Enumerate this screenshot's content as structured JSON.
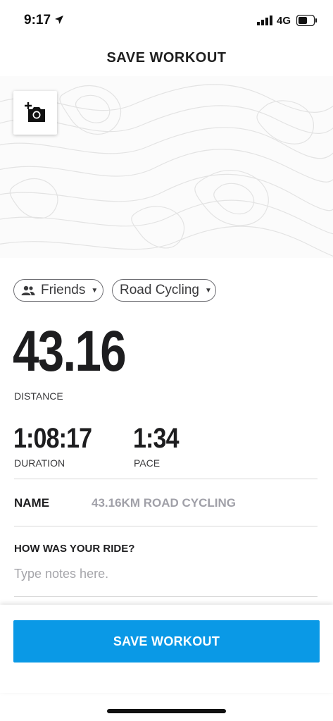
{
  "status_bar": {
    "time": "9:17",
    "network": "4G"
  },
  "header": {
    "title": "SAVE WORKOUT"
  },
  "privacy_chip": {
    "label": "Friends"
  },
  "activity_chip": {
    "label": "Road Cycling"
  },
  "distance": {
    "value": "43.16",
    "label": "DISTANCE"
  },
  "duration": {
    "value": "1:08:17",
    "label": "DURATION"
  },
  "pace": {
    "value": "1:34",
    "label": "PACE"
  },
  "name_row": {
    "label": "NAME",
    "value": "43.16KM ROAD CYCLING"
  },
  "notes": {
    "label": "HOW WAS YOUR RIDE?",
    "placeholder": "Type notes here."
  },
  "footer": {
    "save_label": "SAVE WORKOUT"
  },
  "colors": {
    "primary": "#0a99e6",
    "text": "#1d1d1f",
    "muted": "#a0a0a8"
  }
}
